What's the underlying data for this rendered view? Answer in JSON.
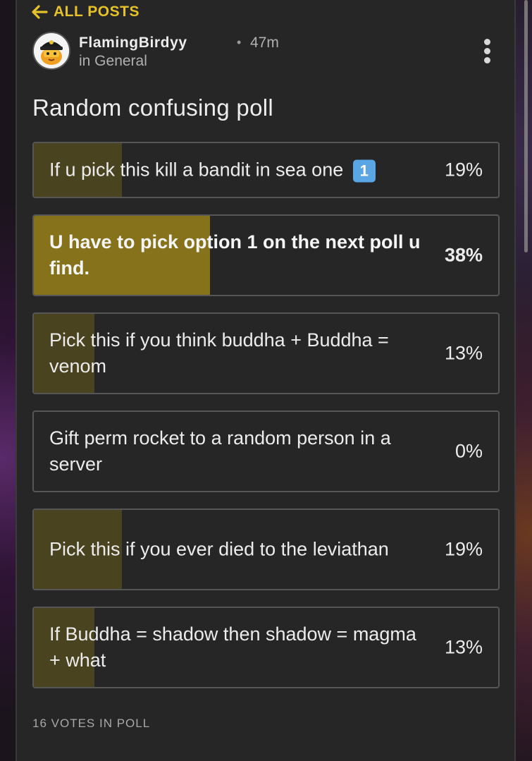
{
  "header": {
    "back_label": "ALL POSTS"
  },
  "post": {
    "author": "FlamingBirdyy",
    "separator": "•",
    "time": "47m",
    "channel": "in General",
    "title": "Random confusing poll"
  },
  "poll": {
    "options": [
      {
        "label": "If u pick this kill a bandit in sea one",
        "badge": "1",
        "percent_text": "19%",
        "percent": 19,
        "selected": false
      },
      {
        "label": "U have to pick option 1 on the next poll u find.",
        "percent_text": "38%",
        "percent": 38,
        "selected": true
      },
      {
        "label": "Pick this if you think buddha + Buddha = venom",
        "percent_text": "13%",
        "percent": 13,
        "selected": false
      },
      {
        "label": "Gift perm rocket to a random person in a server",
        "percent_text": "0%",
        "percent": 0,
        "selected": false
      },
      {
        "label": "Pick this if you ever died to the leviathan",
        "percent_text": "19%",
        "percent": 19,
        "selected": false
      },
      {
        "label": "If Buddha = shadow then shadow = magma + what",
        "percent_text": "13%",
        "percent": 13,
        "selected": false
      }
    ],
    "votes_text": "16 VOTES IN POLL"
  },
  "colors": {
    "accent": "#e6c229",
    "fill": "#4a431f",
    "fill_selected": "#85721a",
    "panel": "#262626",
    "badge": "#5aa6e4"
  }
}
